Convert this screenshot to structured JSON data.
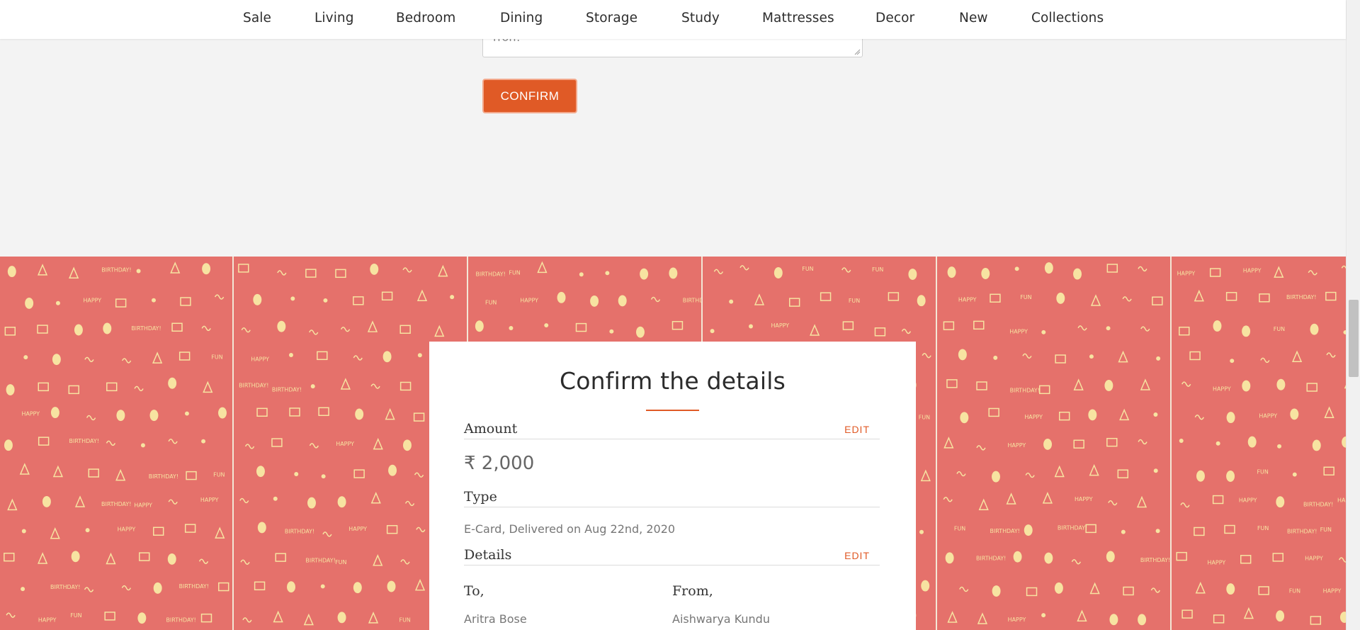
{
  "nav": {
    "items": [
      "Sale",
      "Living",
      "Bedroom",
      "Dining",
      "Storage",
      "Study",
      "Mattresses",
      "Decor",
      "New",
      "Collections"
    ]
  },
  "message": {
    "visible_text": "rron!"
  },
  "form": {
    "confirm_label": "CONFIRM"
  },
  "pattern": {
    "colors": {
      "background": "#e5716b",
      "doodle": "#f7e3a1",
      "divider": "#f3e7d6"
    },
    "doodle_words": [
      "HAPPY",
      "BIRTHDAY!",
      "FUN"
    ]
  },
  "details_card": {
    "title": "Confirm the details",
    "amount_label": "Amount",
    "amount_edit": "EDIT",
    "amount_value": "₹ 2,000",
    "type_label": "Type",
    "type_value": "E-Card, Delivered on Aug 22nd, 2020",
    "details_label": "Details",
    "details_edit": "EDIT",
    "to_label": "To,",
    "to_value": "Aritra Bose",
    "from_label": "From,",
    "from_value": "Aishwarya Kundu"
  },
  "colors": {
    "accent": "#e05a26",
    "page_bg": "#f3f3f3"
  }
}
